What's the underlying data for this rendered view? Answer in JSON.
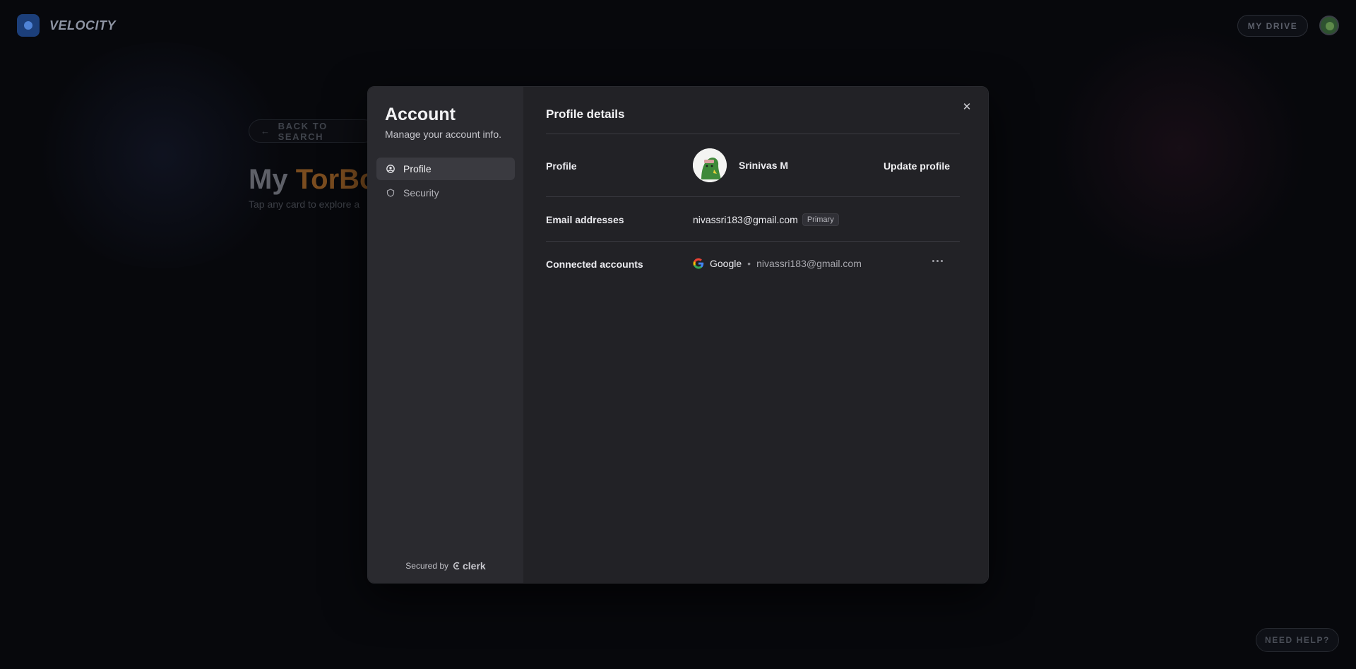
{
  "app": {
    "brand": "VELOCITY",
    "my_drive_label": "MY DRIVE",
    "back_label": "BACK TO SEARCH",
    "title_prefix": "My",
    "title_accent": "TorBox",
    "subtitle": "Tap any card to explore a",
    "need_help_label": "NEED HELP?"
  },
  "modal": {
    "sidebar": {
      "title": "Account",
      "subtitle": "Manage your account info.",
      "items": [
        {
          "label": "Profile",
          "icon": "user-circle-icon",
          "active": true
        },
        {
          "label": "Security",
          "icon": "shield-icon",
          "active": false
        }
      ],
      "secured_by": "Secured by",
      "provider": "clerk"
    },
    "main": {
      "title": "Profile details",
      "profile": {
        "label": "Profile",
        "name": "Srinivas M",
        "update_label": "Update profile"
      },
      "emails": {
        "label": "Email addresses",
        "address": "nivassri183@gmail.com",
        "badge": "Primary"
      },
      "connected": {
        "label": "Connected accounts",
        "provider": "Google",
        "separator": "•",
        "email": "nivassri183@gmail.com"
      }
    }
  },
  "colors": {
    "accent_orange": "#7a4c1f",
    "logo_blue": "#1c3f7a",
    "modal_sidebar": "#2a2a2f",
    "modal_main": "#222226"
  }
}
